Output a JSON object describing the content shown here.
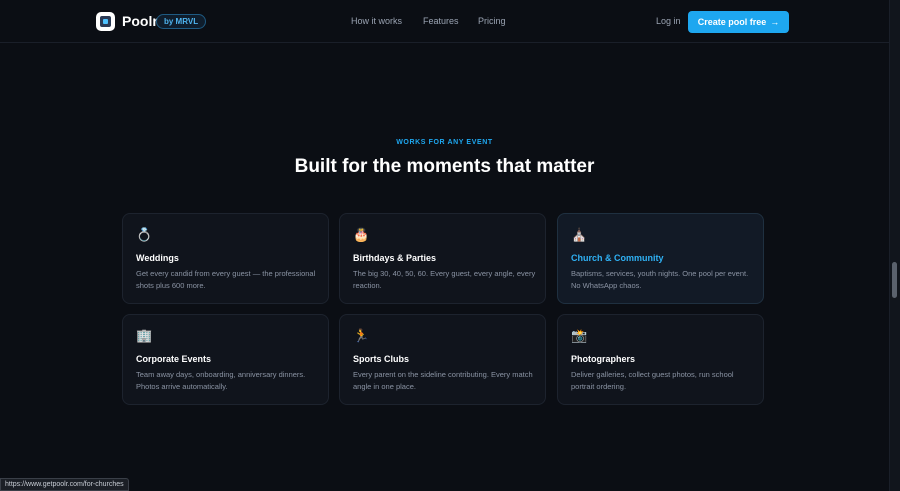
{
  "nav": {
    "brand": "Poolr",
    "badge": "by MRVL",
    "links": [
      "How it works",
      "Features",
      "Pricing"
    ],
    "login": "Log in",
    "cta": "Create pool free",
    "cta_arrow": "→"
  },
  "section": {
    "eyebrow": "WORKS FOR ANY EVENT",
    "title": "Built for the moments that matter"
  },
  "cards": [
    {
      "icon": "💍",
      "icon_name": "ring-icon",
      "title": "Weddings",
      "desc": "Get every candid from every guest — the professional shots plus 600 more."
    },
    {
      "icon": "🎂",
      "icon_name": "cake-icon",
      "title": "Birthdays & Parties",
      "desc": "The big 30, 40, 50, 60. Every guest, every angle, every reaction."
    },
    {
      "icon": "⛪",
      "icon_name": "church-icon",
      "title": "Church & Community",
      "desc": "Baptisms, services, youth nights. One pool per event. No WhatsApp chaos."
    },
    {
      "icon": "🏢",
      "icon_name": "office-building-icon",
      "title": "Corporate Events",
      "desc": "Team away days, onboarding, anniversary dinners. Photos arrive automatically."
    },
    {
      "icon": "🏃",
      "icon_name": "runner-icon",
      "title": "Sports Clubs",
      "desc": "Every parent on the sideline contributing. Every match angle in one place."
    },
    {
      "icon": "📸",
      "icon_name": "camera-flash-icon",
      "title": "Photographers",
      "desc": "Deliver galleries, collect guest photos, run school portrait ordering."
    }
  ],
  "status_bar": {
    "url": "https://www.getpoolr.com/for-churches"
  },
  "colors": {
    "background": "#0b0e14",
    "accent": "#1ea7f0",
    "card": "#10141c"
  }
}
